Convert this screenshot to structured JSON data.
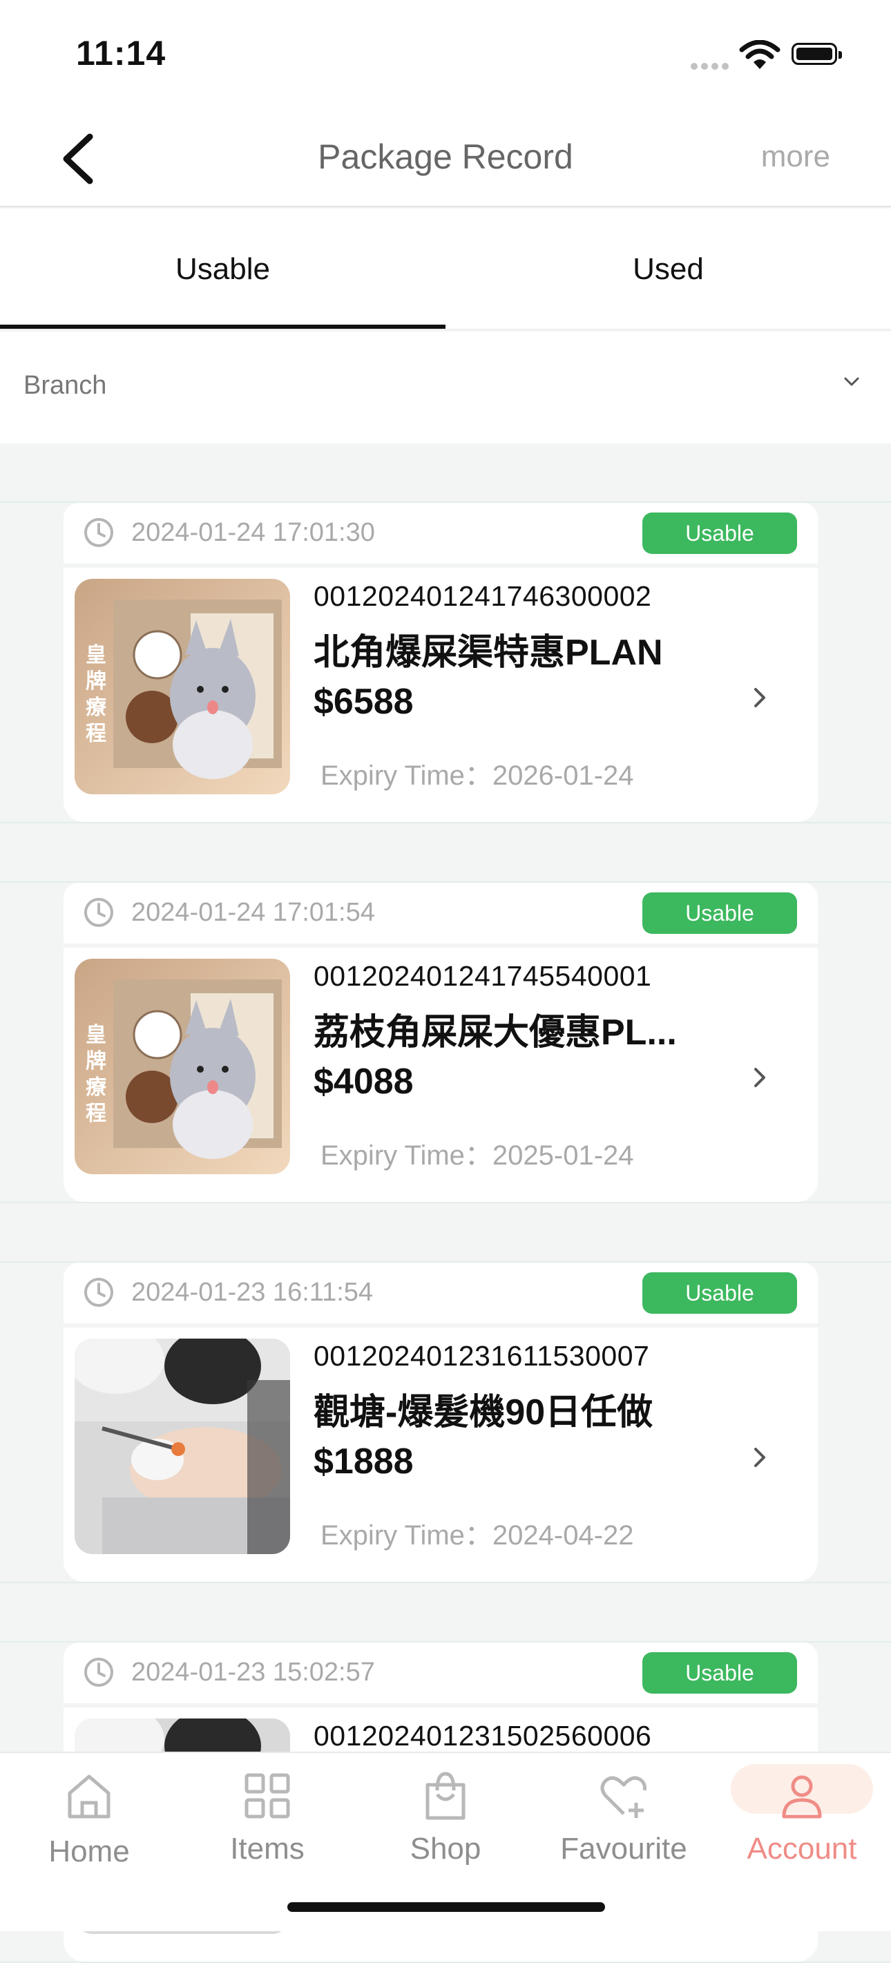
{
  "status_bar": {
    "time": "11:14"
  },
  "header": {
    "title": "Package Record",
    "more_label": "more"
  },
  "tabs": [
    {
      "label": "Usable",
      "active": true
    },
    {
      "label": "Used",
      "active": false
    }
  ],
  "filter": {
    "label": "Branch"
  },
  "records": [
    {
      "created": "2024-01-24 17:01:30",
      "status": "Usable",
      "code": "001202401241746300002",
      "name": "北角爆屎渠特惠PLAN",
      "price": "$6588",
      "expiry": "Expiry Time：2026-01-24",
      "thumb": "cat"
    },
    {
      "created": "2024-01-24 17:01:54",
      "status": "Usable",
      "code": "001202401241745540001",
      "name": "荔枝角屎屎大優惠PL...",
      "price": "$4088",
      "expiry": "Expiry Time：2025-01-24",
      "thumb": "cat"
    },
    {
      "created": "2024-01-23 16:11:54",
      "status": "Usable",
      "code": "001202401231611530007",
      "name": "觀塘-爆髮機90日任做",
      "price": "$1888",
      "expiry": "Expiry Time：2024-04-22",
      "thumb": "facial"
    },
    {
      "created": "2024-01-23 15:02:57",
      "status": "Usable",
      "code": "001202401231502560006",
      "thumb": "facial"
    }
  ],
  "thumb_text": {
    "cat_vertical": "皇牌療程"
  },
  "bottom_nav": [
    {
      "label": "Home",
      "icon": "home-icon"
    },
    {
      "label": "Items",
      "icon": "grid-icon"
    },
    {
      "label": "Shop",
      "icon": "shopping-bag-icon"
    },
    {
      "label": "Favourite",
      "icon": "heart-plus-icon"
    },
    {
      "label": "Account",
      "icon": "user-icon",
      "active": true
    }
  ],
  "colors": {
    "badge": "#3cb85e",
    "active_nav": "#f08c86",
    "active_nav_bg": "#fdeee8"
  }
}
